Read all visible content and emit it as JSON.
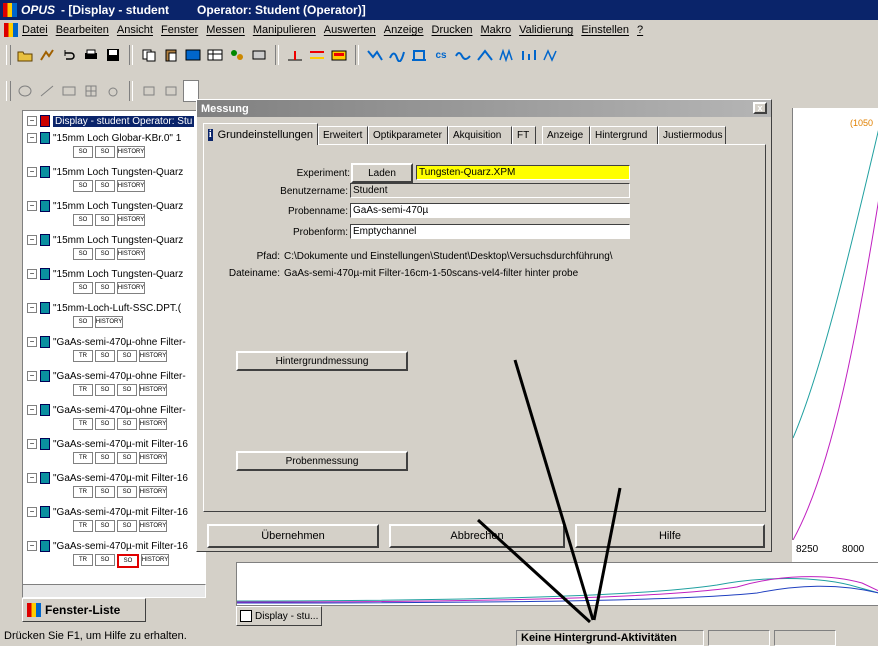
{
  "title_bar": {
    "app": "OPUS",
    "document": " - [Display - student",
    "operator": "Operator: Student  (Operator)]"
  },
  "menu": [
    "Datei",
    "Bearbeiten",
    "Ansicht",
    "Fenster",
    "Messen",
    "Manipulieren",
    "Auswerten",
    "Anzeige",
    "Drucken",
    "Makro",
    "Validierung",
    "Einstellen",
    "?"
  ],
  "tree": {
    "header": "Display - student   Operator: Stu",
    "items": [
      {
        "label": "\"15mm Loch Globar-KBr.0\" 1",
        "blocks": [
          "SO",
          "SO",
          "HISTORY"
        ]
      },
      {
        "label": "\"15mm Loch Tungsten-Quarz",
        "blocks": [
          "SO",
          "SO",
          "HISTORY"
        ]
      },
      {
        "label": "\"15mm Loch Tungsten-Quarz",
        "blocks": [
          "SO",
          "SO",
          "HISTORY"
        ]
      },
      {
        "label": "\"15mm Loch Tungsten-Quarz",
        "blocks": [
          "SO",
          "SO",
          "HISTORY"
        ]
      },
      {
        "label": "\"15mm Loch Tungsten-Quarz",
        "blocks": [
          "SO",
          "SO",
          "HISTORY"
        ]
      },
      {
        "label": "\"15mm-Loch-Luft-SSC.DPT.(",
        "blocks": [
          "SO",
          "HISTORY"
        ]
      },
      {
        "label": "\"GaAs-semi-470µ-ohne Filter-",
        "blocks": [
          "TR",
          "SO",
          "SO",
          "HISTORY"
        ]
      },
      {
        "label": "\"GaAs-semi-470µ-ohne Filter-",
        "blocks": [
          "TR",
          "SO",
          "SO",
          "HISTORY"
        ]
      },
      {
        "label": "\"GaAs-semi-470µ-ohne Filter-",
        "blocks": [
          "TR",
          "SO",
          "SO",
          "HISTORY"
        ]
      },
      {
        "label": "\"GaAs-semi-470µ-mit Filter-16",
        "blocks": [
          "TR",
          "SO",
          "SO",
          "HISTORY"
        ]
      },
      {
        "label": "\"GaAs-semi-470µ-mit Filter-16",
        "blocks": [
          "TR",
          "SO",
          "SO",
          "HISTORY"
        ]
      },
      {
        "label": "\"GaAs-semi-470µ-mit Filter-16",
        "blocks": [
          "TR",
          "SO",
          "SO",
          "HISTORY"
        ]
      },
      {
        "label": "\"GaAs-semi-470µ-mit Filter-16",
        "blocks": [
          "TR",
          "SO",
          "SO",
          "HISTORY"
        ]
      }
    ]
  },
  "window_list_tab": "Fenster-Liste",
  "doc_tab": "Display - stu...",
  "graph": {
    "corner_label": "(1050",
    "x_ticks": [
      "8250",
      "8000"
    ]
  },
  "dialog": {
    "title": "Messung",
    "close": "x",
    "tabs": [
      "Grundeinstellungen",
      "Erweitert",
      "Optikparameter",
      "Akquisition",
      "FT",
      "Anzeige",
      "Hintergrund",
      "Justiermodus"
    ],
    "labels": {
      "experiment": "Experiment:",
      "benutzername": "Benutzername:",
      "probenname": "Probenname:",
      "probenform": "Probenform:",
      "pfad": "Pfad:",
      "dateiname": "Dateiname:"
    },
    "values": {
      "experiment": "Tungsten-Quarz.XPM",
      "benutzername": "Student",
      "probenname": "GaAs-semi-470µ",
      "probenform": "Emptychannel",
      "pfad": "C:\\Dokumente und Einstellungen\\Student\\Desktop\\Versuchsdurchführung\\",
      "dateiname": "GaAs-semi-470µ-mit Filter-16cm-1-50scans-vel4-filter hinter probe"
    },
    "load_button": "Laden",
    "background_button": "Hintergrundmessung",
    "sample_button": "Probenmessung",
    "apply_button": "Übernehmen",
    "cancel_button": "Abbrechen",
    "help_button": "Hilfe"
  },
  "status": {
    "left": "Drücken Sie F1, um Hilfe zu erhalten.",
    "middle": "Keine Hintergrund-Aktivitäten"
  },
  "colors": {
    "title_active": "#0a246a",
    "experiment_highlight": "#ffff00",
    "chart_teal": "#20a0a0",
    "chart_magenta": "#c020c0",
    "arrow": "#000000"
  }
}
